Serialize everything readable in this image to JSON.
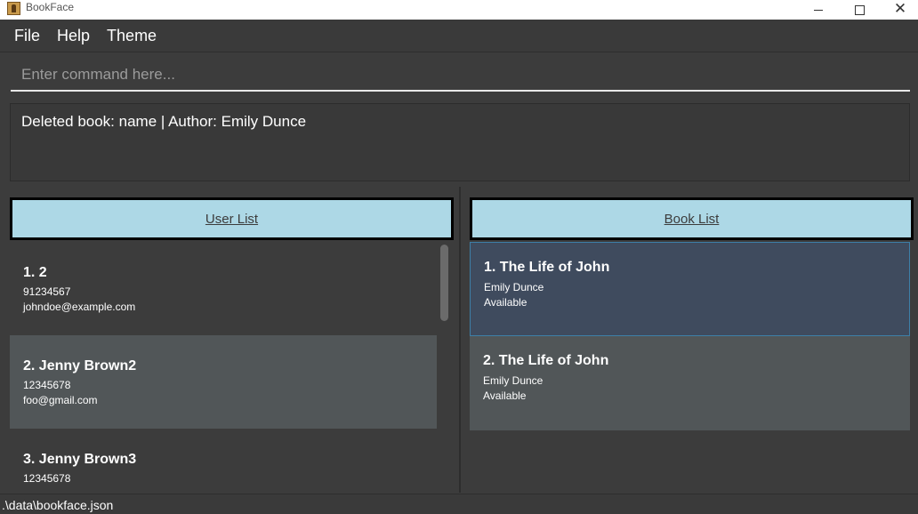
{
  "window": {
    "title": "BookFace",
    "icons": [
      "app-book-icon",
      "minimize-icon",
      "maximize-icon",
      "close-icon"
    ]
  },
  "menu": {
    "items": [
      "File",
      "Help",
      "Theme"
    ]
  },
  "command": {
    "placeholder": "Enter command here...",
    "value": ""
  },
  "result": {
    "text": "Deleted book: name | Author: Emily Dunce"
  },
  "users": {
    "header": "User List",
    "items": [
      {
        "title": "1.  2",
        "phone": "91234567",
        "email": "johndoe@example.com"
      },
      {
        "title": "2.  Jenny Brown2",
        "phone": "12345678",
        "email": "foo@gmail.com"
      },
      {
        "title": "3.  Jenny Brown3",
        "phone": "12345678",
        "email": ""
      }
    ]
  },
  "books": {
    "header": "Book List",
    "items": [
      {
        "title": "1.  The Life of John",
        "author": "Emily Dunce",
        "status": "Available"
      },
      {
        "title": "2.  The  Life of John",
        "author": "Emily Dunce",
        "status": "Available"
      }
    ]
  },
  "status": {
    "path": ".\\data\\bookface.json"
  },
  "colors": {
    "background": "#3c3c3c",
    "header": "#add8e6",
    "selected": "#3f4b5e",
    "alt_row": "#515658"
  }
}
